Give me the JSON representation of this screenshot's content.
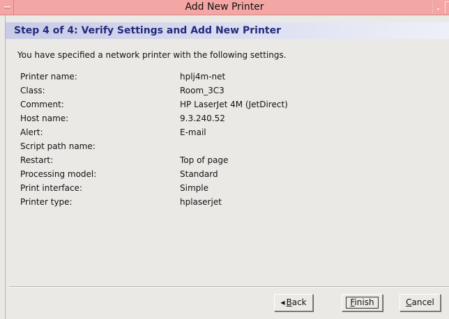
{
  "window": {
    "title": "Add New Printer"
  },
  "header": {
    "step_title": "Step 4 of 4: Verify Settings and Add New Printer"
  },
  "main": {
    "intro": "You have specified a network printer with the following settings.",
    "settings": [
      {
        "label": "Printer name:",
        "value": "hplj4m-net"
      },
      {
        "label": "Class:",
        "value": "Room_3C3"
      },
      {
        "label": "Comment:",
        "value": "HP LaserJet 4M (JetDirect)"
      },
      {
        "label": "Host name:",
        "value": "9.3.240.52"
      },
      {
        "label": "Alert:",
        "value": "E-mail"
      },
      {
        "label": "Script path name:",
        "value": ""
      },
      {
        "label": "Restart:",
        "value": "Top of page"
      },
      {
        "label": "Processing model:",
        "value": "Standard"
      },
      {
        "label": "Print interface:",
        "value": "Simple"
      },
      {
        "label": "Printer type:",
        "value": "hplaserjet"
      }
    ]
  },
  "buttons": {
    "back": {
      "mnemonic": "B",
      "rest": "ack"
    },
    "finish": {
      "mnemonic": "F",
      "rest": "inish"
    },
    "cancel": {
      "mnemonic": "C",
      "rest": "ancel"
    }
  },
  "icons": {
    "back_arrow": "left-triangle-icon"
  },
  "colors": {
    "titlebar": "#f4a6a4",
    "step_title": "#232a7e",
    "header_band": "#c7cbe6",
    "window_bg": "#eae9e6"
  }
}
